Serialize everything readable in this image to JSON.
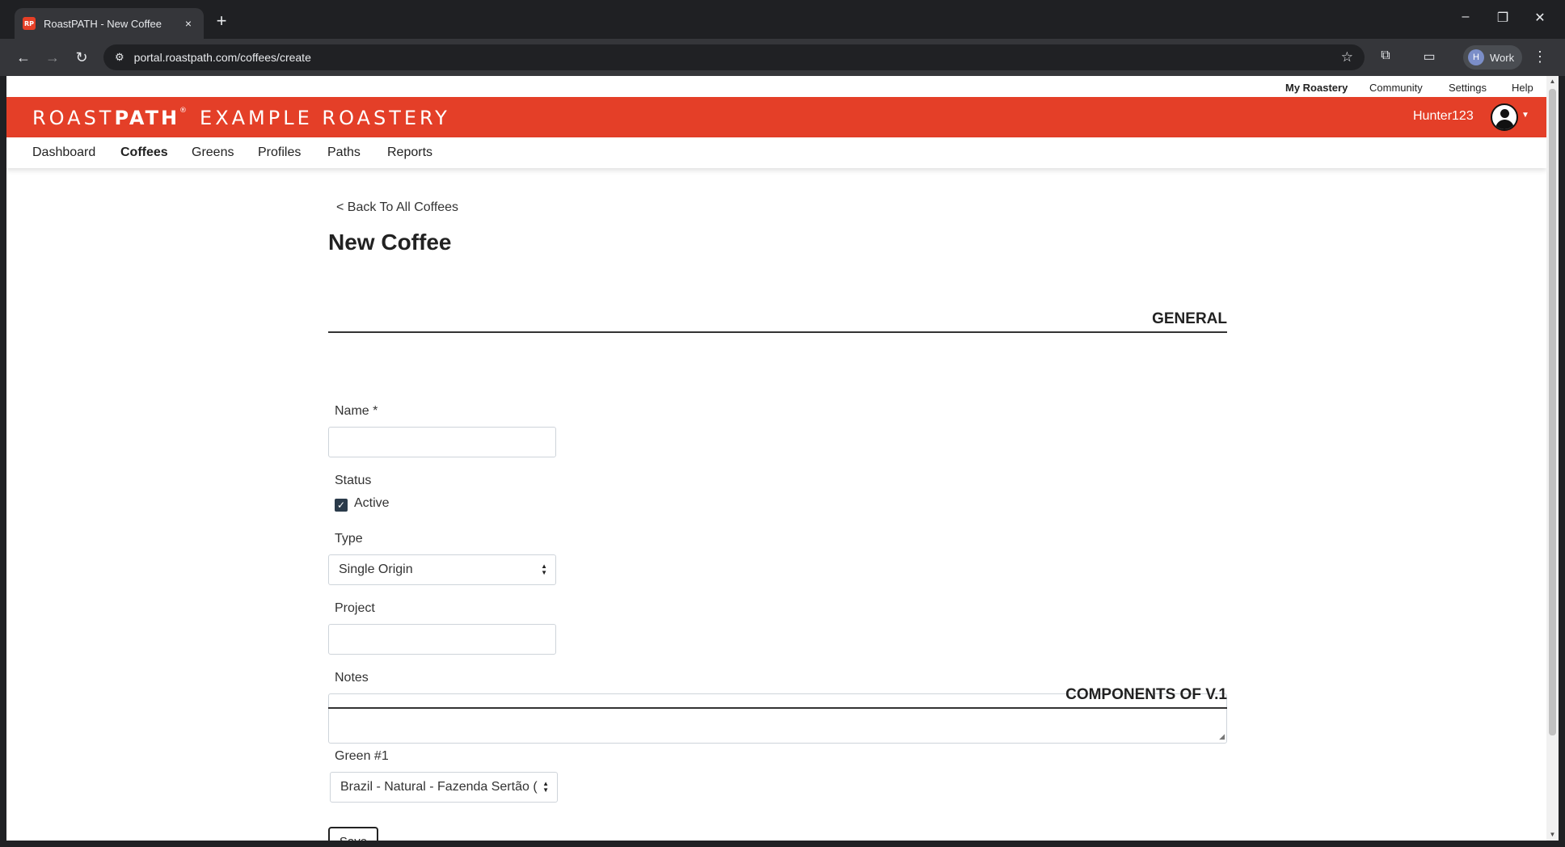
{
  "browser": {
    "tab_title": "RoastPATH - New Coffee",
    "tab_favicon_text": "RP",
    "tab_close_icon": "×",
    "new_tab_icon": "+",
    "url": "portal.roastpath.com/coffees/create",
    "profile_initial": "H",
    "profile_label": "Work",
    "window_controls": [
      "–",
      "❐",
      "✕"
    ],
    "nav": {
      "back": "←",
      "forward": "→",
      "reload": "↻"
    }
  },
  "utility_links": {
    "my_roastery": "My Roastery",
    "community": "Community",
    "settings": "Settings",
    "help": "Help"
  },
  "brand": {
    "name_light": "ROAST",
    "name_bold": "PATH",
    "reg_mark": "®",
    "roastery": "EXAMPLE ROASTERY",
    "color": "#e43f28"
  },
  "user": {
    "name": "Hunter123"
  },
  "main_nav": {
    "dashboard": "Dashboard",
    "coffees": "Coffees",
    "greens": "Greens",
    "profiles": "Profiles",
    "paths": "Paths",
    "reports": "Reports",
    "active": "Coffees"
  },
  "form": {
    "back_link": "< Back To All Coffees",
    "page_title": "New Coffee",
    "general_section": "GENERAL",
    "name_label": "Name *",
    "name_value": "",
    "status_label": "Status",
    "active_label": "Active",
    "active_checked": true,
    "type_label": "Type",
    "type_value": "Single Origin",
    "project_label": "Project",
    "project_value": "",
    "notes_label": "Notes",
    "notes_value": "",
    "components_section": "COMPONENTS OF V.1",
    "green_label": "Green #1",
    "green_value": "Brazil - Natural - Fazenda Sertão (",
    "save_label": "Save"
  }
}
